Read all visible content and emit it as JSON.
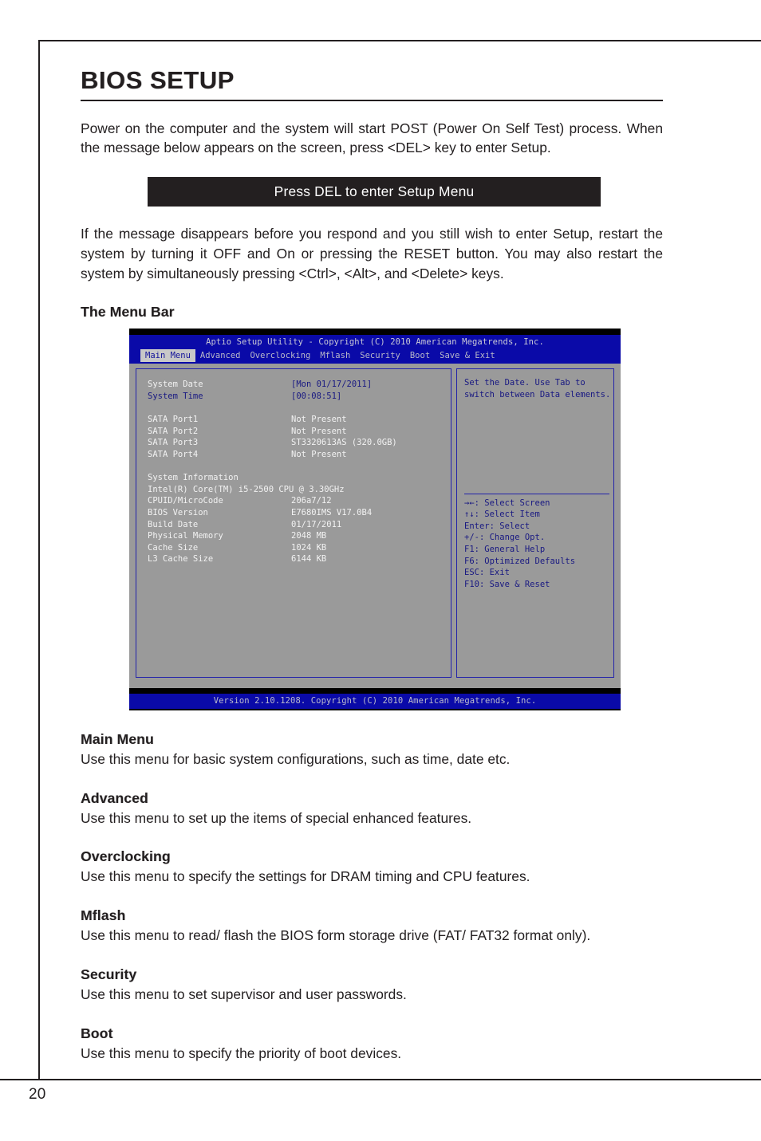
{
  "page": {
    "number": "20"
  },
  "document": {
    "title": "BIOS SETUP",
    "intro_paragraph": "Power on the computer and the system will start POST (Power On Self Test) process. When the message below appears on the screen, press <DEL> key to enter Setup.",
    "banner_text": "Press DEL to enter Setup Menu",
    "second_paragraph": "If the message disappears before you respond and you still wish to enter Setup, restart the system by turning it OFF and On or pressing the RESET button. You may also restart the system by simultaneously pressing <Ctrl>, <Alt>, and <Delete> keys.",
    "menu_bar_heading": "The Menu Bar"
  },
  "bios": {
    "title_bar": "Aptio Setup Utility - Copyright (C) 2010 American Megatrends, Inc.",
    "tabs": [
      {
        "label": "Main Menu",
        "active": true
      },
      {
        "label": "Advanced",
        "active": false
      },
      {
        "label": "Overclocking",
        "active": false
      },
      {
        "label": "Mflash",
        "active": false
      },
      {
        "label": "Security",
        "active": false
      },
      {
        "label": "Boot",
        "active": false
      },
      {
        "label": "Save & Exit",
        "active": false
      }
    ],
    "settings": [
      {
        "label": "System Date",
        "value": "[Mon 01/17/2011]",
        "selected": true
      },
      {
        "label": "System Time",
        "value": "[00:08:51]",
        "selected": false
      }
    ],
    "sata_ports": [
      {
        "label": "SATA Port1",
        "value": "Not Present"
      },
      {
        "label": "SATA Port2",
        "value": "Not Present"
      },
      {
        "label": "SATA Port3",
        "value": "ST3320613AS (320.0GB)"
      },
      {
        "label": "SATA Port4",
        "value": "Not Present"
      }
    ],
    "system_information": {
      "heading": "System Information",
      "cpu": "Intel(R) Core(TM) i5-2500 CPU @ 3.30GHz",
      "items": [
        {
          "label": "CPUID/MicroCode",
          "value": "206a7/12"
        },
        {
          "label": "BIOS Version",
          "value": "E7680IMS V17.0B4"
        },
        {
          "label": "Build Date",
          "value": "01/17/2011"
        },
        {
          "label": "Physical Memory",
          "value": "2048 MB"
        },
        {
          "label": "Cache Size",
          "value": "1024 KB"
        },
        {
          "label": "L3 Cache Size",
          "value": "6144 KB"
        }
      ]
    },
    "help": {
      "line1": "Set the Date. Use Tab to",
      "line2": "switch between Data elements."
    },
    "key_bindings": [
      "→←: Select Screen",
      "↑↓: Select Item",
      "Enter: Select",
      "+/-: Change Opt.",
      "F1: General Help",
      "F6: Optimized Defaults",
      "ESC: Exit",
      "F10: Save & Reset"
    ],
    "version_bar": "Version 2.10.1208. Copyright (C) 2010 American Megatrends, Inc.",
    "colors": {
      "blue": "#0a0aa8",
      "gray": "#9a9a9a",
      "text_blue": "#191982",
      "text_white": "#f2f2f2"
    }
  },
  "sections": [
    {
      "heading": "Main Menu",
      "body": "Use this menu for basic system configurations, such as time, date etc."
    },
    {
      "heading": "Advanced",
      "body": "Use this menu to set up the items of special enhanced features."
    },
    {
      "heading": "Overclocking",
      "body": "Use this menu to specify the settings for DRAM timing and CPU features."
    },
    {
      "heading": "Mflash",
      "body": "Use this menu to read/ flash the BIOS form storage drive (FAT/ FAT32 format only)."
    },
    {
      "heading": "Security",
      "body": "Use this menu to set supervisor and user passwords."
    },
    {
      "heading": "Boot",
      "body": "Use this menu to specify the priority of boot devices."
    }
  ]
}
